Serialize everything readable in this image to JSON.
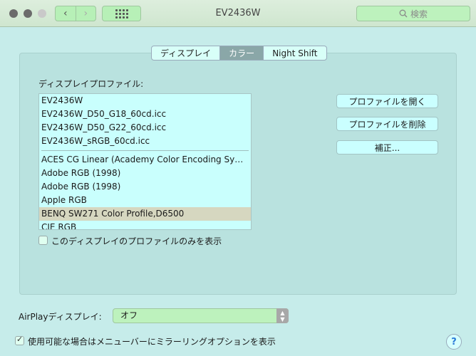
{
  "window": {
    "title": "EV2436W"
  },
  "toolbar": {
    "back_glyph": "‹",
    "forward_glyph": "›",
    "search_placeholder": "検索"
  },
  "tabs": [
    {
      "label": "ディスプレイ",
      "active": false
    },
    {
      "label": "カラー",
      "active": true
    },
    {
      "label": "Night Shift",
      "active": false
    }
  ],
  "profile_section": {
    "label": "ディスプレイプロファイル:",
    "group1": [
      "EV2436W",
      "EV2436W_D50_G18_60cd.icc",
      "EV2436W_D50_G22_60cd.icc",
      "EV2436W_sRGB_60cd.icc"
    ],
    "group2": [
      "ACES CG Linear (Academy Color Encoding Sy…",
      "Adobe RGB (1998)",
      "Adobe RGB (1998)",
      "Apple RGB",
      "BENQ SW271 Color Profile,D6500",
      "CIE RGB"
    ],
    "selected": "BENQ SW271 Color Profile,D6500",
    "only_this_display_label": "このディスプレイのプロファイルのみを表示",
    "only_this_display_checked": false
  },
  "buttons": {
    "open_profile": "プロファイルを開く",
    "delete_profile": "プロファイルを削除",
    "calibrate": "補正..."
  },
  "airplay": {
    "label": "AirPlayディスプレイ:",
    "value": "オフ"
  },
  "mirroring": {
    "label": "使用可能な場合はメニューバーにミラーリングオプションを表示",
    "checked": true
  },
  "help": {
    "glyph": "?"
  }
}
